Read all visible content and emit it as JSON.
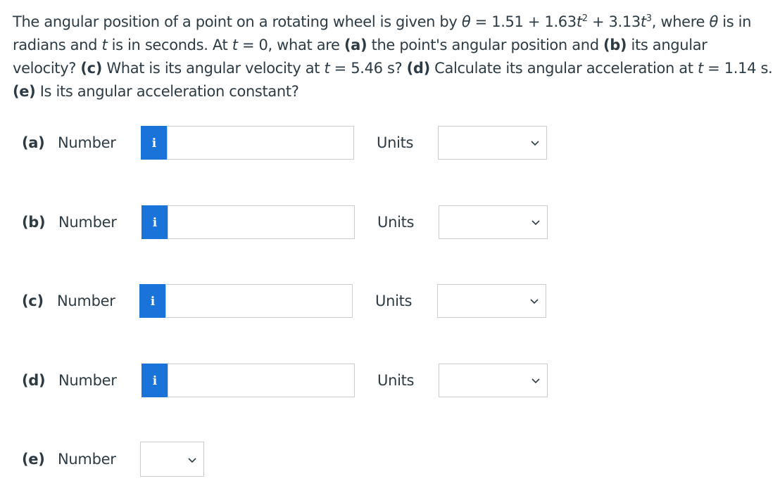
{
  "question": {
    "p1": "The angular position of a point on a rotating wheel is given by ",
    "theta": "θ",
    "eq1": " = 1.51 + 1.63",
    "t": "t",
    "sq": "2",
    "eq2": " + 3.13",
    "cube": "3",
    "p2": ", where ",
    "p3": " is in radians and ",
    "p4": " is in seconds. At ",
    "p5": " = 0, what are ",
    "a": "(a)",
    "p6": " the point's angular position and ",
    "b": "(b)",
    "p7": " its angular velocity? ",
    "c": "(c)",
    "p8": " What is its angular velocity at ",
    "p9": " = 5.46 s? ",
    "d": "(d)",
    "p10": " Calculate its angular acceleration at ",
    "p11": " = 1.14 s. ",
    "e": "(e)",
    "p12": " Is its angular acceleration constant?"
  },
  "parts": [
    {
      "label": "(a)",
      "number_label": "Number",
      "info": "i",
      "value": "",
      "units_label": "Units",
      "units_value": ""
    },
    {
      "label": "(b)",
      "number_label": "Number",
      "info": "i",
      "value": "",
      "units_label": "Units",
      "units_value": ""
    },
    {
      "label": "(c)",
      "number_label": "Number",
      "info": "i",
      "value": "",
      "units_label": "Units",
      "units_value": ""
    },
    {
      "label": "(d)",
      "number_label": "Number",
      "info": "i",
      "value": "",
      "units_label": "Units",
      "units_value": ""
    },
    {
      "label": "(e)",
      "number_label": "Number",
      "select_value": ""
    }
  ],
  "icons": {
    "info": "info-icon",
    "dropdown": "chevron-down-icon"
  },
  "colors": {
    "text": "#2d3b45",
    "info_button": "#1a73d9",
    "border": "#c7cdd1"
  }
}
